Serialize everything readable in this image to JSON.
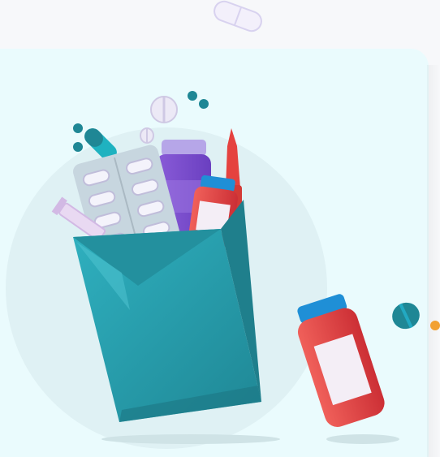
{
  "scene": {
    "subject": "medicine-bag",
    "items": [
      "paper-bag",
      "blister-pack",
      "pill-bottle-purple",
      "pill-bottle-red",
      "ampoule",
      "syringe",
      "capsule",
      "round-tablet",
      "pill-bottle-falling",
      "tablet-blue"
    ]
  },
  "colors": {
    "background": "#f7f8fa",
    "card": "#eafbfd",
    "circle": "#dff1f4",
    "bag": "#2aa3b3",
    "bag_dark": "#1f7f8c",
    "red": "#e0403f",
    "blue": "#1f8fd6",
    "purple": "#7f4fd0",
    "teal": "#25a6b5",
    "orange": "#f2a132"
  }
}
